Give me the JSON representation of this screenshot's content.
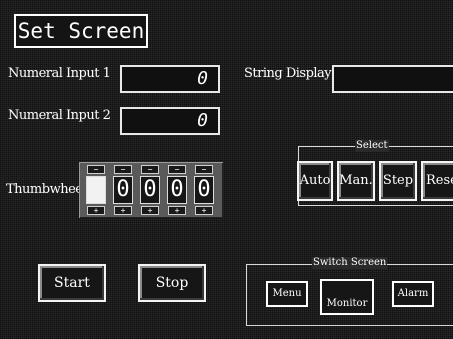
{
  "screen": {
    "title": "Set Screen"
  },
  "numeral1": {
    "label": "Numeral Input 1",
    "value": "0"
  },
  "numeral2": {
    "label": "Numeral Input 2",
    "value": "0"
  },
  "string_display": {
    "label": "String Display",
    "value": ""
  },
  "thumbwheel": {
    "label": "Thumbwheel",
    "digits": [
      "",
      "0",
      "0",
      "0",
      "0"
    ],
    "up_glyph": "−",
    "down_glyph": "+"
  },
  "select": {
    "title": "Select",
    "buttons": [
      "Auto",
      "Man.",
      "Step",
      "Reset"
    ]
  },
  "controls": {
    "start_label": "Start",
    "stop_label": "Stop"
  },
  "switch_screen": {
    "title": "Switch Screen",
    "buttons": [
      "Menu",
      "Monitor",
      "Alarm"
    ]
  },
  "colors": {
    "background": "#2a2a2a",
    "foreground": "#ffffff",
    "selected_digit": "#f2f2f2"
  }
}
